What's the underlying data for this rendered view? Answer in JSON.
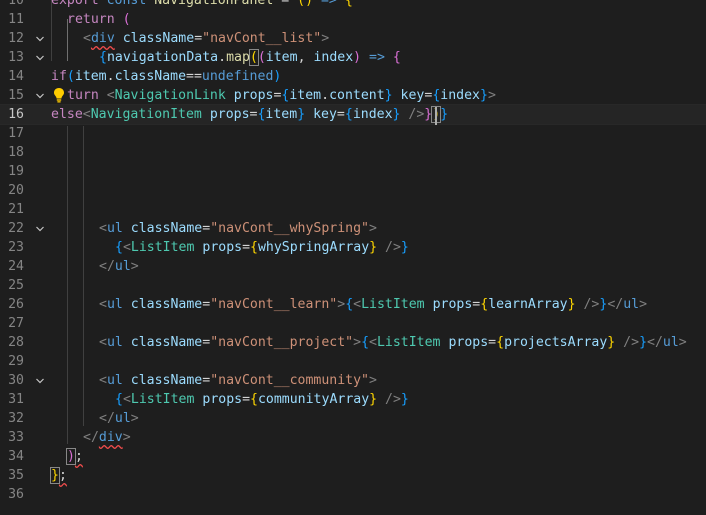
{
  "editor": {
    "language": "javascript-react",
    "current_line": "16",
    "lines": [
      {
        "n": "10",
        "tokens": [
          {
            "t": "export ",
            "c": "kw"
          },
          {
            "t": "const ",
            "c": "st"
          },
          {
            "t": "NavigationPanel",
            "c": "fn"
          },
          {
            "t": " = ",
            "c": "tx"
          },
          {
            "t": "(",
            "c": "b1"
          },
          {
            "t": ")",
            "c": "b1"
          },
          {
            "t": " => ",
            "c": "st"
          },
          {
            "t": "{",
            "c": "b1"
          }
        ]
      },
      {
        "n": "11",
        "tokens": [
          {
            "t": "return ",
            "c": "kw"
          },
          {
            "t": "(",
            "c": "b2"
          }
        ]
      },
      {
        "n": "12",
        "tokens": [
          {
            "t": "<",
            "c": "pn"
          },
          {
            "t": "div",
            "c": "st",
            "sq": true
          },
          {
            "t": " className",
            "c": "at"
          },
          {
            "t": "=",
            "c": "tx"
          },
          {
            "t": "\"navCont__list\"",
            "c": "sg"
          },
          {
            "t": ">",
            "c": "pn"
          }
        ]
      },
      {
        "n": "13",
        "tokens": [
          {
            "t": "{",
            "c": "b3"
          },
          {
            "t": "navigationData",
            "c": "vr"
          },
          {
            "t": ".",
            "c": "tx"
          },
          {
            "t": "map",
            "c": "fn"
          },
          {
            "t": "(",
            "c": "b1",
            "bm": true
          },
          {
            "t": "(",
            "c": "b2"
          },
          {
            "t": "item",
            "c": "vr"
          },
          {
            "t": ", ",
            "c": "tx"
          },
          {
            "t": "index",
            "c": "vr"
          },
          {
            "t": ")",
            "c": "b2"
          },
          {
            "t": " => ",
            "c": "st"
          },
          {
            "t": "{",
            "c": "b2"
          }
        ]
      },
      {
        "n": "14",
        "tokens": [
          {
            "t": "if",
            "c": "kw"
          },
          {
            "t": "(",
            "c": "b3"
          },
          {
            "t": "item",
            "c": "vr"
          },
          {
            "t": ".",
            "c": "tx"
          },
          {
            "t": "className",
            "c": "vr"
          },
          {
            "t": "==",
            "c": "tx"
          },
          {
            "t": "undefined",
            "c": "st"
          },
          {
            "t": ")",
            "c": "b3"
          }
        ]
      },
      {
        "n": "15",
        "tokens": [
          {
            "t": "turn ",
            "c": "kw"
          },
          {
            "t": "<",
            "c": "pn"
          },
          {
            "t": "NavigationLink",
            "c": "tg"
          },
          {
            "t": " props",
            "c": "at"
          },
          {
            "t": "=",
            "c": "tx"
          },
          {
            "t": "{",
            "c": "b3"
          },
          {
            "t": "item",
            "c": "vr"
          },
          {
            "t": ".",
            "c": "tx"
          },
          {
            "t": "content",
            "c": "vr"
          },
          {
            "t": "}",
            "c": "b3"
          },
          {
            "t": " key",
            "c": "at"
          },
          {
            "t": "=",
            "c": "tx"
          },
          {
            "t": "{",
            "c": "b3"
          },
          {
            "t": "index",
            "c": "vr"
          },
          {
            "t": "}",
            "c": "b3"
          },
          {
            "t": ">",
            "c": "pn"
          }
        ]
      },
      {
        "n": "16",
        "tokens": [
          {
            "t": "else",
            "c": "kw"
          },
          {
            "t": "<",
            "c": "pn"
          },
          {
            "t": "NavigationItem",
            "c": "tg"
          },
          {
            "t": " props",
            "c": "at"
          },
          {
            "t": "=",
            "c": "tx"
          },
          {
            "t": "{",
            "c": "b3"
          },
          {
            "t": "item",
            "c": "vr"
          },
          {
            "t": "}",
            "c": "b3"
          },
          {
            "t": " key",
            "c": "at"
          },
          {
            "t": "=",
            "c": "tx"
          },
          {
            "t": "{",
            "c": "b3"
          },
          {
            "t": "index",
            "c": "vr"
          },
          {
            "t": "}",
            "c": "b3"
          },
          {
            "t": " />",
            "c": "pn"
          },
          {
            "t": "}",
            "c": "b2"
          },
          {
            "t": ")",
            "c": "b1",
            "bm": true
          },
          {
            "t": "}",
            "c": "b3"
          }
        ]
      },
      {
        "n": "17",
        "tokens": []
      },
      {
        "n": "18",
        "tokens": []
      },
      {
        "n": "19",
        "tokens": []
      },
      {
        "n": "20",
        "tokens": []
      },
      {
        "n": "21",
        "tokens": []
      },
      {
        "n": "22",
        "tokens": [
          {
            "t": "<",
            "c": "pn"
          },
          {
            "t": "ul",
            "c": "st"
          },
          {
            "t": " className",
            "c": "at"
          },
          {
            "t": "=",
            "c": "tx"
          },
          {
            "t": "\"navCont__whySpring\"",
            "c": "sg"
          },
          {
            "t": ">",
            "c": "pn"
          }
        ]
      },
      {
        "n": "23",
        "tokens": [
          {
            "t": "{",
            "c": "b3"
          },
          {
            "t": "<",
            "c": "pn"
          },
          {
            "t": "ListItem",
            "c": "tg"
          },
          {
            "t": " props",
            "c": "at"
          },
          {
            "t": "=",
            "c": "tx"
          },
          {
            "t": "{",
            "c": "b1"
          },
          {
            "t": "whySpringArray",
            "c": "vr"
          },
          {
            "t": "}",
            "c": "b1"
          },
          {
            "t": " />",
            "c": "pn"
          },
          {
            "t": "}",
            "c": "b3"
          }
        ]
      },
      {
        "n": "24",
        "tokens": [
          {
            "t": "</",
            "c": "pn"
          },
          {
            "t": "ul",
            "c": "st"
          },
          {
            "t": ">",
            "c": "pn"
          }
        ]
      },
      {
        "n": "25",
        "tokens": []
      },
      {
        "n": "26",
        "tokens": [
          {
            "t": "<",
            "c": "pn"
          },
          {
            "t": "ul",
            "c": "st"
          },
          {
            "t": " className",
            "c": "at"
          },
          {
            "t": "=",
            "c": "tx"
          },
          {
            "t": "\"navCont__learn\"",
            "c": "sg"
          },
          {
            "t": ">",
            "c": "pn"
          },
          {
            "t": "{",
            "c": "b3"
          },
          {
            "t": "<",
            "c": "pn"
          },
          {
            "t": "ListItem",
            "c": "tg"
          },
          {
            "t": " props",
            "c": "at"
          },
          {
            "t": "=",
            "c": "tx"
          },
          {
            "t": "{",
            "c": "b1"
          },
          {
            "t": "learnArray",
            "c": "vr"
          },
          {
            "t": "}",
            "c": "b1"
          },
          {
            "t": " />",
            "c": "pn"
          },
          {
            "t": "}",
            "c": "b3"
          },
          {
            "t": "</",
            "c": "pn"
          },
          {
            "t": "ul",
            "c": "st"
          },
          {
            "t": ">",
            "c": "pn"
          }
        ]
      },
      {
        "n": "27",
        "tokens": []
      },
      {
        "n": "28",
        "tokens": [
          {
            "t": "<",
            "c": "pn"
          },
          {
            "t": "ul",
            "c": "st"
          },
          {
            "t": " className",
            "c": "at"
          },
          {
            "t": "=",
            "c": "tx"
          },
          {
            "t": "\"navCont__project\"",
            "c": "sg"
          },
          {
            "t": ">",
            "c": "pn"
          },
          {
            "t": "{",
            "c": "b3"
          },
          {
            "t": "<",
            "c": "pn"
          },
          {
            "t": "ListItem",
            "c": "tg"
          },
          {
            "t": " props",
            "c": "at"
          },
          {
            "t": "=",
            "c": "tx"
          },
          {
            "t": "{",
            "c": "b1"
          },
          {
            "t": "projectsArray",
            "c": "vr"
          },
          {
            "t": "}",
            "c": "b1"
          },
          {
            "t": " />",
            "c": "pn"
          },
          {
            "t": "}",
            "c": "b3"
          },
          {
            "t": "</",
            "c": "pn"
          },
          {
            "t": "ul",
            "c": "st"
          },
          {
            "t": ">",
            "c": "pn"
          }
        ]
      },
      {
        "n": "29",
        "tokens": []
      },
      {
        "n": "30",
        "tokens": [
          {
            "t": "<",
            "c": "pn"
          },
          {
            "t": "ul",
            "c": "st"
          },
          {
            "t": " className",
            "c": "at"
          },
          {
            "t": "=",
            "c": "tx"
          },
          {
            "t": "\"navCont__community\"",
            "c": "sg"
          },
          {
            "t": ">",
            "c": "pn"
          }
        ]
      },
      {
        "n": "31",
        "tokens": [
          {
            "t": "{",
            "c": "b3"
          },
          {
            "t": "<",
            "c": "pn"
          },
          {
            "t": "ListItem",
            "c": "tg"
          },
          {
            "t": " props",
            "c": "at"
          },
          {
            "t": "=",
            "c": "tx"
          },
          {
            "t": "{",
            "c": "b1"
          },
          {
            "t": "communityArray",
            "c": "vr"
          },
          {
            "t": "}",
            "c": "b1"
          },
          {
            "t": " />",
            "c": "pn"
          },
          {
            "t": "}",
            "c": "b3"
          }
        ]
      },
      {
        "n": "32",
        "tokens": [
          {
            "t": "</",
            "c": "pn"
          },
          {
            "t": "ul",
            "c": "st"
          },
          {
            "t": ">",
            "c": "pn"
          }
        ]
      },
      {
        "n": "33",
        "tokens": [
          {
            "t": "</",
            "c": "pn"
          },
          {
            "t": "div",
            "c": "st",
            "sq": true
          },
          {
            "t": ">",
            "c": "pn"
          }
        ]
      },
      {
        "n": "34",
        "tokens": [
          {
            "t": ")",
            "c": "b2",
            "bm": true
          },
          {
            "t": ";",
            "c": "tx",
            "sq": true
          }
        ]
      },
      {
        "n": "35",
        "tokens": [
          {
            "t": "}",
            "c": "b1",
            "bm": true
          },
          {
            "t": ";",
            "c": "tx",
            "sq": true
          }
        ]
      },
      {
        "n": "36",
        "tokens": []
      }
    ]
  }
}
